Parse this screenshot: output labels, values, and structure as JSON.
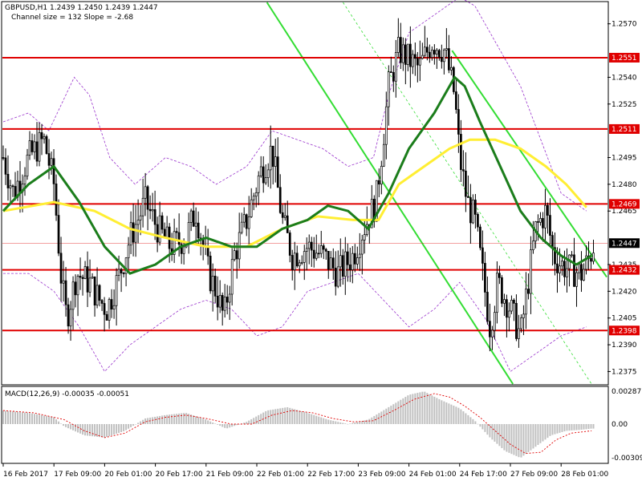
{
  "header": {
    "symbol_line": "GBPUSD,H1  1.2439 1.2450 1.2439 1.2447",
    "channel_line": "Channel size = 132 Slope = -2.68"
  },
  "colors": {
    "background": "#ffffff",
    "candle": "#000000",
    "level_line": "#e00000",
    "level_label_bg": "#e00000",
    "level_label_text": "#ffffff",
    "ma_fast": "#1b7d1b",
    "ma_slow": "#ffee33",
    "channel_main": "#33dd33",
    "channel_mid": "#33dd33",
    "bands": "#9933cc",
    "macd_hist": "#c0c0c0",
    "macd_signal": "#e00000",
    "current_price_bg": "#000000"
  },
  "chart_data": [
    {
      "type": "candlestick",
      "title": "GBPUSD,H1",
      "x": [
        "16 Feb 2017",
        "17 Feb 09:00",
        "20 Feb 01:00",
        "20 Feb 17:00",
        "21 Feb 09:00",
        "22 Feb 01:00",
        "22 Feb 17:00",
        "23 Feb 09:00",
        "24 Feb 01:00",
        "24 Feb 17:00",
        "27 Feb 09:00",
        "28 Feb 01:00"
      ],
      "ylim": [
        1.2368,
        1.2582
      ],
      "y_ticks": [
        "1.2570",
        "1.2540",
        "1.2525",
        "1.2495",
        "1.2480",
        "1.2465",
        "1.2435",
        "1.2420",
        "1.2405",
        "1.2390",
        "1.2375"
      ],
      "levels": [
        {
          "label": "1.2551",
          "value": 1.2551
        },
        {
          "label": "1.2511",
          "value": 1.2511
        },
        {
          "label": "1.2469",
          "value": 1.2469
        },
        {
          "label": "1.2432",
          "value": 1.2432
        },
        {
          "label": "1.2398",
          "value": 1.2398
        }
      ],
      "current_price": {
        "label": "1.2447",
        "value": 1.2447
      },
      "close_path": [
        [
          0,
          1.2495
        ],
        [
          0.2,
          1.2475
        ],
        [
          0.5,
          1.2495
        ],
        [
          0.8,
          1.2505
        ],
        [
          1.0,
          1.248
        ],
        [
          1.15,
          1.2425
        ],
        [
          1.25,
          1.2405
        ],
        [
          1.45,
          1.243
        ],
        [
          1.7,
          1.2425
        ],
        [
          1.9,
          1.2415
        ],
        [
          2.05,
          1.241
        ],
        [
          2.3,
          1.243
        ],
        [
          2.5,
          1.245
        ],
        [
          2.8,
          1.247
        ],
        [
          3.05,
          1.2455
        ],
        [
          3.3,
          1.2445
        ],
        [
          3.6,
          1.245
        ],
        [
          3.8,
          1.2465
        ],
        [
          4.05,
          1.243
        ],
        [
          4.2,
          1.242
        ],
        [
          4.35,
          1.2405
        ],
        [
          4.55,
          1.244
        ],
        [
          4.8,
          1.246
        ],
        [
          5.05,
          1.2485
        ],
        [
          5.3,
          1.25
        ],
        [
          5.5,
          1.246
        ],
        [
          5.7,
          1.244
        ],
        [
          6.0,
          1.2445
        ],
        [
          6.3,
          1.244
        ],
        [
          6.6,
          1.243
        ],
        [
          6.9,
          1.244
        ],
        [
          7.1,
          1.2455
        ],
        [
          7.35,
          1.247
        ],
        [
          7.45,
          1.2495
        ],
        [
          7.6,
          1.2535
        ],
        [
          7.8,
          1.2555
        ],
        [
          8.0,
          1.255
        ],
        [
          8.2,
          1.2545
        ],
        [
          8.45,
          1.256
        ],
        [
          8.7,
          1.2555
        ],
        [
          8.9,
          1.253
        ],
        [
          9.0,
          1.2495
        ],
        [
          9.15,
          1.247
        ],
        [
          9.3,
          1.246
        ],
        [
          9.5,
          1.242
        ],
        [
          9.6,
          1.24
        ],
        [
          9.75,
          1.2425
        ],
        [
          10.0,
          1.241
        ],
        [
          10.2,
          1.2395
        ],
        [
          10.35,
          1.2425
        ],
        [
          10.5,
          1.2455
        ],
        [
          10.7,
          1.2465
        ],
        [
          10.85,
          1.244
        ],
        [
          11.0,
          1.2435
        ],
        [
          11.2,
          1.2432
        ],
        [
          11.4,
          1.243
        ],
        [
          11.55,
          1.2438
        ],
        [
          11.65,
          1.2447
        ]
      ],
      "ma_fast_path": [
        [
          0,
          1.2465
        ],
        [
          0.5,
          1.248
        ],
        [
          1.0,
          1.249
        ],
        [
          1.5,
          1.247
        ],
        [
          2.0,
          1.2445
        ],
        [
          2.5,
          1.243
        ],
        [
          3.0,
          1.2435
        ],
        [
          3.5,
          1.2445
        ],
        [
          4.0,
          1.245
        ],
        [
          4.5,
          1.2445
        ],
        [
          5.0,
          1.2445
        ],
        [
          5.5,
          1.2455
        ],
        [
          6.0,
          1.246
        ],
        [
          6.4,
          1.2468
        ],
        [
          6.8,
          1.2465
        ],
        [
          7.2,
          1.2455
        ],
        [
          7.6,
          1.2475
        ],
        [
          8.0,
          1.25
        ],
        [
          8.5,
          1.252
        ],
        [
          8.9,
          1.254
        ],
        [
          9.1,
          1.2535
        ],
        [
          9.4,
          1.2515
        ],
        [
          9.8,
          1.249
        ],
        [
          10.2,
          1.2465
        ],
        [
          10.6,
          1.245
        ],
        [
          11.0,
          1.244
        ],
        [
          11.3,
          1.2435
        ],
        [
          11.6,
          1.244
        ]
      ],
      "ma_slow_path": [
        [
          0,
          1.2465
        ],
        [
          1.0,
          1.247
        ],
        [
          1.8,
          1.2465
        ],
        [
          2.5,
          1.2455
        ],
        [
          3.2,
          1.245
        ],
        [
          4.0,
          1.2445
        ],
        [
          4.8,
          1.2445
        ],
        [
          5.5,
          1.2455
        ],
        [
          6.2,
          1.2462
        ],
        [
          6.9,
          1.246
        ],
        [
          7.4,
          1.246
        ],
        [
          7.8,
          1.248
        ],
        [
          8.3,
          1.249
        ],
        [
          8.8,
          1.25
        ],
        [
          9.2,
          1.2505
        ],
        [
          9.7,
          1.2505
        ],
        [
          10.2,
          1.25
        ],
        [
          10.7,
          1.249
        ],
        [
          11.1,
          1.248
        ],
        [
          11.5,
          1.2467
        ]
      ],
      "band_upper_path": [
        [
          0,
          1.2515
        ],
        [
          0.5,
          1.252
        ],
        [
          0.9,
          1.251
        ],
        [
          1.4,
          1.254
        ],
        [
          1.7,
          1.253
        ],
        [
          2.1,
          1.2495
        ],
        [
          2.6,
          1.248
        ],
        [
          3.2,
          1.2495
        ],
        [
          3.7,
          1.249
        ],
        [
          4.2,
          1.248
        ],
        [
          4.8,
          1.249
        ],
        [
          5.3,
          1.251
        ],
        [
          5.8,
          1.2505
        ],
        [
          6.3,
          1.25
        ],
        [
          6.8,
          1.249
        ],
        [
          7.3,
          1.2495
        ],
        [
          7.6,
          1.253
        ],
        [
          8.0,
          1.2565
        ],
        [
          8.5,
          1.2575
        ],
        [
          9.0,
          1.2585
        ],
        [
          9.3,
          1.258
        ],
        [
          9.8,
          1.2555
        ],
        [
          10.2,
          1.2535
        ],
        [
          10.6,
          1.2505
        ],
        [
          11.0,
          1.2475
        ],
        [
          11.5,
          1.2465
        ]
      ],
      "band_lower_path": [
        [
          0,
          1.243
        ],
        [
          0.5,
          1.243
        ],
        [
          1.0,
          1.242
        ],
        [
          1.5,
          1.24
        ],
        [
          2.0,
          1.2375
        ],
        [
          2.5,
          1.239
        ],
        [
          3.0,
          1.24
        ],
        [
          3.5,
          1.241
        ],
        [
          4.0,
          1.2415
        ],
        [
          4.5,
          1.241
        ],
        [
          5.0,
          1.2395
        ],
        [
          5.5,
          1.24
        ],
        [
          6.0,
          1.242
        ],
        [
          6.5,
          1.2425
        ],
        [
          7.0,
          1.243
        ],
        [
          7.5,
          1.2415
        ],
        [
          8.0,
          1.24
        ],
        [
          8.5,
          1.241
        ],
        [
          9.0,
          1.2425
        ],
        [
          9.5,
          1.2405
        ],
        [
          10.0,
          1.2375
        ],
        [
          10.5,
          1.2385
        ],
        [
          11.0,
          1.2395
        ],
        [
          11.5,
          1.24
        ]
      ],
      "channel_lines": [
        {
          "from": [
            5.2,
            1.2582
          ],
          "to": [
            10.05,
            1.2368
          ],
          "style": "solid"
        },
        {
          "from": [
            8.85,
            1.2555
          ],
          "to": [
            11.9,
            1.2428
          ],
          "style": "solid"
        },
        {
          "from": [
            6.7,
            1.2582
          ],
          "to": [
            11.6,
            1.2368
          ],
          "style": "dashed"
        }
      ]
    },
    {
      "type": "bar",
      "title": "MACD(12,26,9) -0.00035 -0.00051",
      "ylim": [
        -0.00035,
        0.00032
      ],
      "y_ticks": [
        "0.00287",
        "0.00",
        "-0.00309"
      ],
      "hist_path": [
        [
          0,
          0.00012
        ],
        [
          0.5,
          0.0001
        ],
        [
          1.0,
          6e-05
        ],
        [
          1.2,
          -2e-05
        ],
        [
          1.6,
          -0.0001
        ],
        [
          2.0,
          -0.00012
        ],
        [
          2.4,
          -6e-05
        ],
        [
          2.8,
          5e-05
        ],
        [
          3.2,
          8e-05
        ],
        [
          3.6,
          0.0001
        ],
        [
          4.0,
          4e-05
        ],
        [
          4.4,
          -4e-05
        ],
        [
          4.8,
          2e-05
        ],
        [
          5.2,
          0.00012
        ],
        [
          5.6,
          0.00015
        ],
        [
          6.0,
          0.0001
        ],
        [
          6.4,
          4e-05
        ],
        [
          6.8,
          0.0
        ],
        [
          7.2,
          4e-05
        ],
        [
          7.6,
          0.00015
        ],
        [
          8.0,
          0.00026
        ],
        [
          8.3,
          0.00029
        ],
        [
          8.6,
          0.00022
        ],
        [
          9.0,
          0.00014
        ],
        [
          9.3,
          3e-05
        ],
        [
          9.6,
          -0.00012
        ],
        [
          9.9,
          -0.00024
        ],
        [
          10.2,
          -0.0003
        ],
        [
          10.5,
          -0.0002
        ],
        [
          10.8,
          -0.0001
        ],
        [
          11.1,
          -6e-05
        ],
        [
          11.4,
          -5e-05
        ],
        [
          11.6,
          -4e-05
        ]
      ],
      "signal_path": [
        [
          0,
          0.00012
        ],
        [
          0.6,
          0.0001
        ],
        [
          1.2,
          4e-05
        ],
        [
          1.6,
          -6e-05
        ],
        [
          2.0,
          -0.00012
        ],
        [
          2.4,
          -8e-05
        ],
        [
          2.8,
          2e-05
        ],
        [
          3.2,
          6e-05
        ],
        [
          3.6,
          8e-05
        ],
        [
          4.0,
          5e-05
        ],
        [
          4.5,
          0.0
        ],
        [
          4.9,
          0.0
        ],
        [
          5.3,
          8e-05
        ],
        [
          5.7,
          0.00012
        ],
        [
          6.1,
          0.0001
        ],
        [
          6.5,
          5e-05
        ],
        [
          6.9,
          2e-05
        ],
        [
          7.3,
          3e-05
        ],
        [
          7.7,
          0.00012
        ],
        [
          8.1,
          0.00022
        ],
        [
          8.5,
          0.00027
        ],
        [
          8.8,
          0.00024
        ],
        [
          9.1,
          0.00016
        ],
        [
          9.4,
          6e-05
        ],
        [
          9.7,
          -6e-05
        ],
        [
          10.0,
          -0.00018
        ],
        [
          10.3,
          -0.00026
        ],
        [
          10.6,
          -0.00025
        ],
        [
          10.9,
          -0.00014
        ],
        [
          11.2,
          -8e-05
        ],
        [
          11.6,
          -6e-05
        ]
      ]
    }
  ]
}
